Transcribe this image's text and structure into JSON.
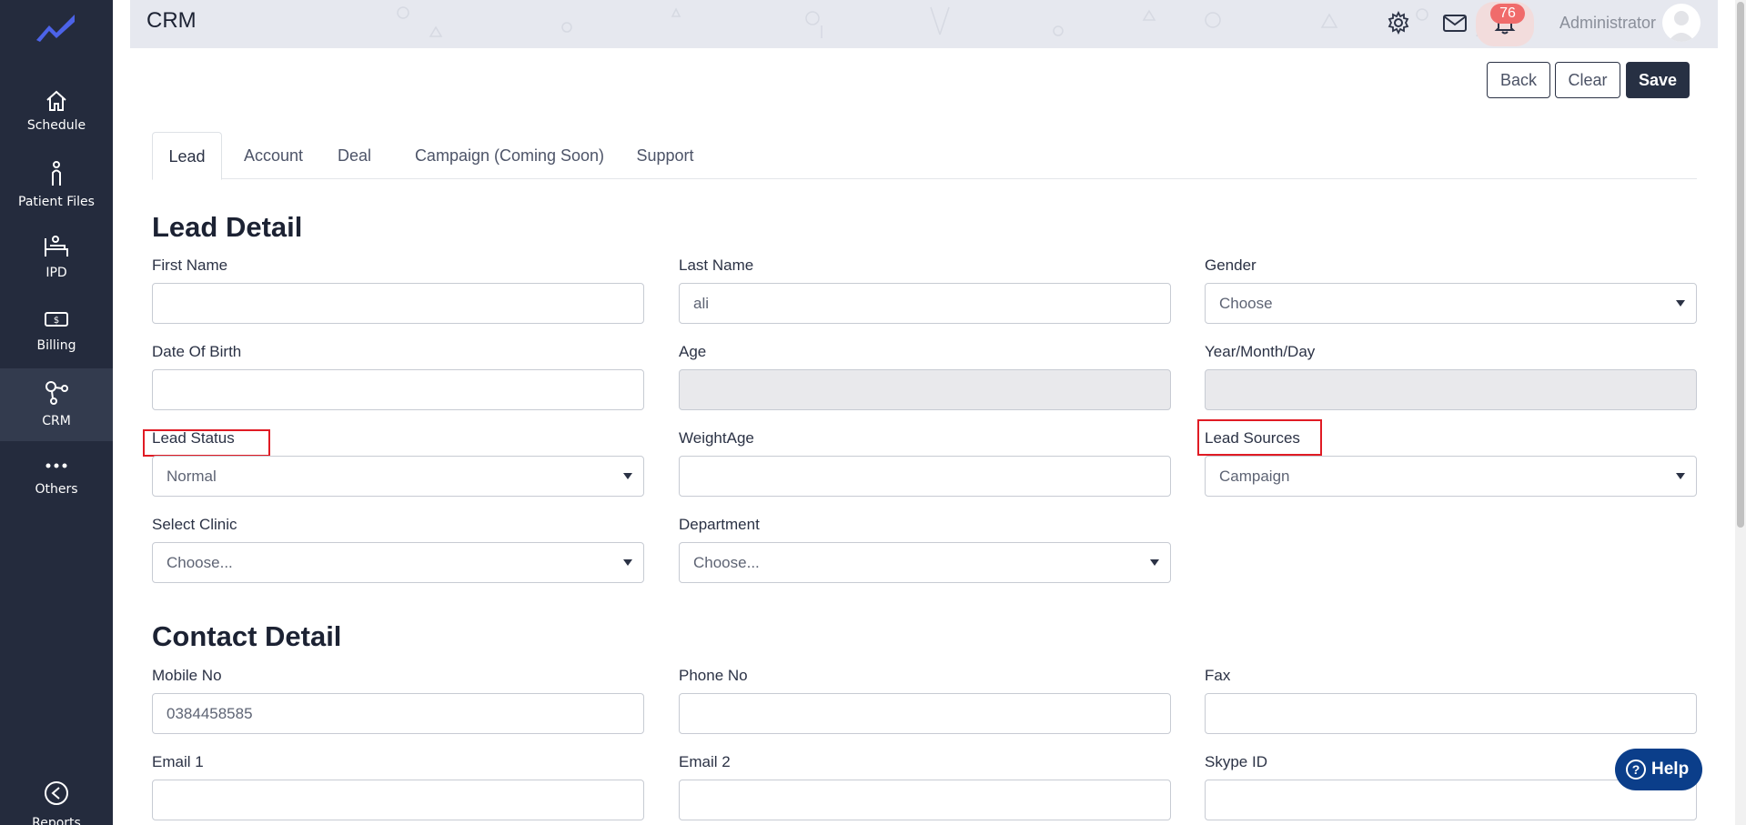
{
  "sidebar": {
    "logo_icon": "trend-line-icon",
    "items": [
      {
        "label": "Schedule",
        "icon": "home-icon"
      },
      {
        "label": "Patient Files",
        "icon": "person-icon"
      },
      {
        "label": "IPD",
        "icon": "bed-icon"
      },
      {
        "label": "Billing",
        "icon": "money-icon"
      },
      {
        "label": "CRM",
        "icon": "network-icon"
      },
      {
        "label": "Others",
        "icon": "more-dots-icon"
      },
      {
        "label": "Reports",
        "icon": "chevron-left-circle-icon"
      }
    ]
  },
  "header": {
    "title": "CRM",
    "notification_count": "76",
    "user_name": "Administrator"
  },
  "actions": {
    "back": "Back",
    "clear": "Clear",
    "save": "Save"
  },
  "tabs": [
    "Lead",
    "Account",
    "Deal",
    "Campaign (Coming Soon)",
    "Support"
  ],
  "lead_detail": {
    "title": "Lead Detail",
    "first_name": {
      "label": "First Name",
      "value": ""
    },
    "last_name": {
      "label": "Last Name",
      "value": "ali"
    },
    "gender": {
      "label": "Gender",
      "value": "Choose"
    },
    "dob": {
      "label": "Date Of Birth",
      "value": ""
    },
    "age": {
      "label": "Age",
      "value": ""
    },
    "ymd": {
      "label": "Year/Month/Day",
      "value": ""
    },
    "lead_status": {
      "label": "Lead Status",
      "value": "Normal"
    },
    "weightage": {
      "label": "WeightAge",
      "value": ""
    },
    "lead_sources": {
      "label": "Lead Sources",
      "value": "Campaign"
    },
    "clinic": {
      "label": "Select Clinic",
      "value": "Choose..."
    },
    "department": {
      "label": "Department",
      "value": "Choose..."
    }
  },
  "contact_detail": {
    "title": "Contact Detail",
    "mobile": {
      "label": "Mobile No",
      "value": "0384458585"
    },
    "phone": {
      "label": "Phone No",
      "value": ""
    },
    "fax": {
      "label": "Fax",
      "value": ""
    },
    "email1": {
      "label": "Email 1",
      "value": ""
    },
    "email2": {
      "label": "Email 2",
      "value": ""
    },
    "skype": {
      "label": "Skype ID",
      "value": ""
    }
  },
  "help": {
    "label": "Help"
  },
  "colors": {
    "sidebar": "#242b3d",
    "primary_button": "#273043",
    "highlight": "#e01b24",
    "badge": "#f06b6b",
    "help": "#0b3e8a"
  }
}
